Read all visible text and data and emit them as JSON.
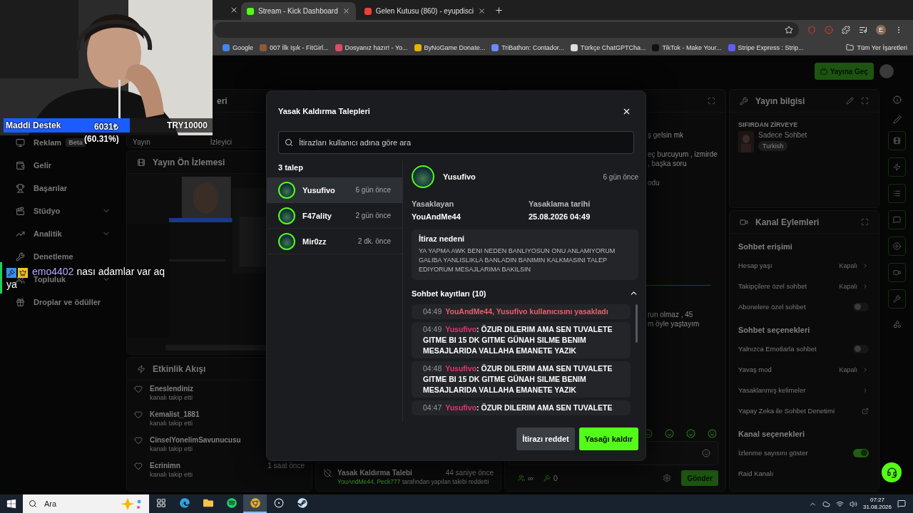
{
  "browser": {
    "tabs": [
      {
        "title": "Stream - Kick Dashboard",
        "kind": "kick",
        "selected": true
      },
      {
        "title": "Gelen Kutusu (860) - eyupdisci",
        "kind": "mail",
        "selected": false
      }
    ],
    "bookmarks": [
      "Google",
      "007 İlk Işık - FitGirl...",
      "Dosyanız hazır! - Yo...",
      "ByNoGame Donate...",
      "TriBathon: Contador...",
      "Türkçe ChatGPTCha...",
      "TikTok - Make Your...",
      "Stripe Express : Strip..."
    ],
    "all_bookmarks": "Tüm Yer İşaretleri",
    "profile_initial": "E"
  },
  "donation": {
    "label": "Maddi Destek",
    "amount": "6031₺",
    "percent": "(60.31%)",
    "goal": "TRY10000",
    "level": 0.6031
  },
  "chat_overlay": {
    "user": "emo4402",
    "text": "nası adamlar var aq ya"
  },
  "header": {
    "go_live": "Yayına Geç"
  },
  "sidebar": {
    "items": [
      {
        "label": "Reklam",
        "badge": "Beta",
        "expandable": false
      },
      {
        "label": "Gelir",
        "expandable": false
      },
      {
        "label": "Başarılar",
        "expandable": false
      },
      {
        "label": "Stüdyo",
        "expandable": true
      },
      {
        "label": "Analitik",
        "expandable": true
      },
      {
        "label": "Denetleme",
        "expandable": false
      },
      {
        "label": "Topluluk",
        "expandable": true
      },
      {
        "label": "Droplar ve ödüller",
        "expandable": false
      }
    ]
  },
  "stats": {
    "title": "eri",
    "labels": [
      "Yayın",
      "İzleyici"
    ]
  },
  "preview": {
    "title": "Yayın Ön İzlemesi"
  },
  "activity": {
    "title": "Etkinlik Akışı",
    "items": [
      {
        "name": "Eneslendiniz",
        "action": "kanalı takip etti"
      },
      {
        "name": "Kemalist_1881",
        "action": "kanalı takip etti"
      },
      {
        "name": "CinselYonelimSavunucusu",
        "action": "kanalı takip etti"
      },
      {
        "name": "Ecrinimn",
        "action": "kanalı takip etti",
        "time": "1 saat önce"
      }
    ]
  },
  "mod_log": {
    "title": "Yasak Kaldırma Talebi",
    "time": "44 saniye önce",
    "actors": "YouAndMe44, Peck777",
    "action": " tarafından yapılan talebi reddetti"
  },
  "chat": {
    "earlier": [
      {
        "lines": [
          "ş gelsin mk"
        ]
      },
      {
        "lines": [
          "eç burcuyum , izmirde",
          ", başka soru"
        ]
      },
      {
        "lines": [
          "odu"
        ]
      }
    ],
    "recent": [
      {
        "lines": [
          "run olmaz , 45",
          "m öyle yaştayım"
        ]
      }
    ],
    "counters": [
      "∞",
      "0"
    ],
    "send": "Gönder"
  },
  "stream_info": {
    "title": "Yayın bilgisi",
    "stream_title": "SIFIRDAN ZİRVEYE",
    "category": "Sadece Sohbet",
    "tag": "Turkish"
  },
  "channel_actions": {
    "title": "Kanal Eylemleri",
    "sections": [
      {
        "title": "Sohbet erişimi",
        "rows": [
          {
            "kind": "value",
            "label": "Hesap yaşı",
            "value": "Kapalı"
          },
          {
            "kind": "value",
            "label": "Takipçilere özel sohbet",
            "value": "Kapalı"
          },
          {
            "kind": "toggle",
            "label": "Abonelere özel sohbet",
            "on": false
          }
        ]
      },
      {
        "title": "Sohbet seçenekleri",
        "rows": [
          {
            "kind": "toggle",
            "label": "Yalnızca Emotlarla sohbet",
            "on": false
          },
          {
            "kind": "value",
            "label": "Yavaş mod",
            "value": "Kapalı"
          },
          {
            "kind": "link",
            "label": "Yasaklanmış kelimeler"
          },
          {
            "kind": "external",
            "label": "Yapay Zeka ile Sohbet Denetimi"
          }
        ]
      },
      {
        "title": "Kanal seçenekleri",
        "rows": [
          {
            "kind": "toggle",
            "label": "İzlenme sayısını göster",
            "on": true
          },
          {
            "kind": "plain",
            "label": "Raid Kanalı"
          }
        ]
      }
    ]
  },
  "modal": {
    "title": "Yasak Kaldırma Talepleri",
    "search_placeholder": "İtirazları kullanıcı adına göre ara",
    "count": "3 talep",
    "requests": [
      {
        "name": "Yusufivo",
        "time": "6 gün önce",
        "selected": true
      },
      {
        "name": "F47ality",
        "time": "2 gün önce",
        "selected": false
      },
      {
        "name": "Mir0zz",
        "time": "2 dk. önce",
        "selected": false
      }
    ],
    "detail": {
      "name": "Yusufivo",
      "time": "6 gün önce",
      "banned_by_label": "Yasaklayan",
      "banned_by": "YouAndMe44",
      "date_label": "Yasaklama tarihi",
      "date": "25.08.2026 04:49",
      "reason_title": "İtiraz nedeni",
      "reason": "YA YAPMA AWK BENI NEDEN BANLIYOSUN ONU ANLAMIYORUM GALIBA YANLISLIKLA BANLADIN BANIMIN KALKMASINI TALEP EDIYORUM MESAJLARIMA BAKILSIN",
      "logs_title": "Sohbet kayıtları (10)",
      "logs_expanded": true,
      "logs": [
        {
          "kind": "ban",
          "time": "04:49",
          "text": "YouAndMe44, Yusufivo kullanıcısını yasakladı"
        },
        {
          "kind": "message",
          "time": "04:49",
          "user": "Yusufivo",
          "text": ": ÖZUR DILERIM AMA SEN TUVALETE GITME BI 15 DK GITME GÜNAH SILME BENIM MESAJLARIDA VALLAHA EMANETE YAZIK"
        },
        {
          "kind": "message",
          "time": "04:48",
          "user": "Yusufivo",
          "text": ": ÖZUR DILERIM AMA SEN TUVALETE GITME BI 15 DK GITME GÜNAH SILME BENIM MESAJLARIDA VALLAHA EMANETE YAZIK"
        },
        {
          "kind": "message",
          "time": "04:47",
          "user": "Yusufivo",
          "text": ": ÖZUR DILERIM AMA SEN TUVALETE"
        }
      ]
    },
    "buttons": [
      {
        "label": "İtirazı reddet",
        "kind": "secondary"
      },
      {
        "label": "Yasağı kaldır",
        "kind": "primary"
      }
    ]
  },
  "taskbar": {
    "search_placeholder": "Ara",
    "apps": [
      {
        "selected": false
      },
      {
        "selected": false
      },
      {
        "selected": false
      },
      {
        "selected": false
      },
      {
        "selected": true
      },
      {
        "selected": false
      },
      {
        "selected": false
      }
    ],
    "time": "07:27",
    "date": "31.08.2026"
  }
}
